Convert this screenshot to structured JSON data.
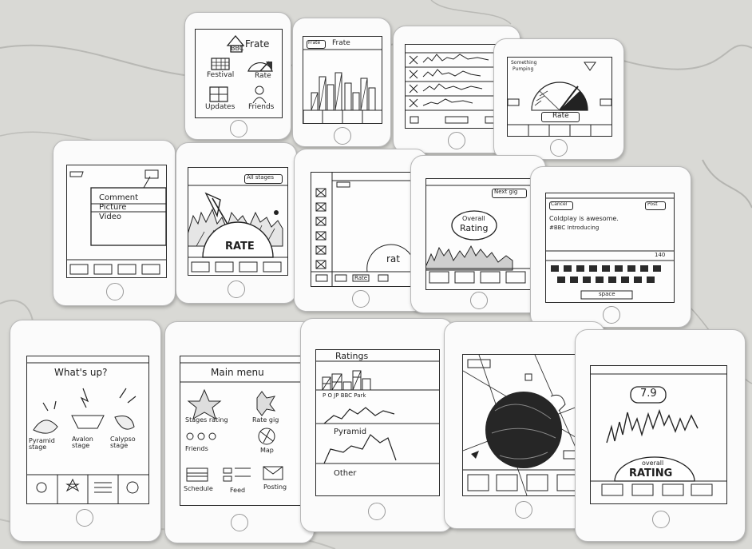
{
  "row1": {
    "c1": {
      "brand": "Frate",
      "logo": "BBC",
      "festival": "Festival",
      "rate": "Rate",
      "updates": "Updates",
      "friends": "Friends"
    },
    "c2": {
      "back": "Frate",
      "title": "Frate"
    },
    "c4": {
      "title_line1": "Something",
      "title_line2": "Pumping",
      "button": "Rate"
    }
  },
  "row2": {
    "c1": {
      "menu": [
        "Comment",
        "Picture",
        "Video"
      ]
    },
    "c2": {
      "tab": "All stages",
      "rate": "RATE"
    },
    "c3": {
      "rate_button": "Rate",
      "label": "rat"
    },
    "c4": {
      "next": "Next gig",
      "bubble_line1": "Overall",
      "bubble_line2": "Rating"
    },
    "c5": {
      "cancel": "Cancel",
      "post": "Post",
      "tweet_line1": "Coldplay is awesome.",
      "tweet_line2": "#BBC Introducing",
      "count": "140",
      "space": "space"
    }
  },
  "row3": {
    "c1": {
      "title": "What's up?",
      "stage1": "Pyramid stage",
      "stage2": "Avalon stage",
      "stage3": "Calypso stage"
    },
    "c2": {
      "title": "Main menu",
      "stages": "Stages rating",
      "rategig": "Rate gig",
      "friends": "Friends",
      "map": "Map",
      "schedule": "Schedule",
      "feed": "Feed",
      "posting": "Posting"
    },
    "c3": {
      "title": "Ratings",
      "axis": "P   O  JP BBC Park",
      "pyramid": "Pyramid",
      "other": "Other"
    },
    "c5": {
      "score": "7.9",
      "overall": "overall",
      "rating": "RATING"
    }
  }
}
